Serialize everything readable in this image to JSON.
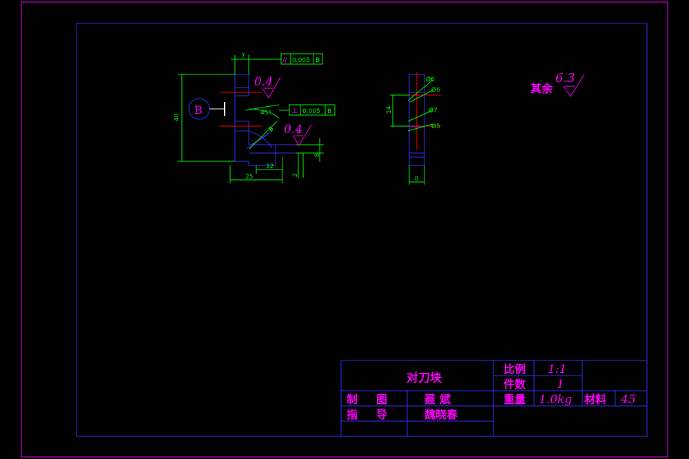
{
  "colors": {
    "background": "#000000",
    "outer_frame": "#ff00ff",
    "inner_frame": "#3333ff",
    "part": "#3333ff",
    "dimension": "#00ff00",
    "annotation": "#ff00ff",
    "centerline": "#ff0000"
  },
  "front_view": {
    "datum_label": "B",
    "dim_top": "7",
    "dim_height": "40",
    "dim_angle": "45°",
    "dim_chamfer": "8",
    "dim_12": "12",
    "dim_25": "25",
    "dim_8": "8",
    "dim_2": "2",
    "roughness_top": "0.4",
    "roughness_bottom": "0.4",
    "parallel_symbol": "//",
    "parallel_tolerance": "0.005",
    "parallel_datum": "B",
    "perp_symbol": "⊥",
    "perp_tolerance": "0.005",
    "perp_datum": "B"
  },
  "side_view": {
    "dim_14": "14",
    "dim_8": "8",
    "hole_dia_1": "Ø6",
    "hole_dia_2": "Ø6",
    "hole_dia_3": "Ø7",
    "hole_dia_4": "Ø5"
  },
  "other_roughness": {
    "label": "其余",
    "value": "6.3"
  },
  "title_block": {
    "part_name": "对刀块",
    "scale_label": "比例",
    "scale_value": "1:1",
    "count_label": "件数",
    "count_value": "1",
    "weight_label": "重量",
    "weight_value": "1.0kg",
    "material_label": "材料",
    "material_value": "45",
    "drawn_label_1": "制",
    "drawn_label_2": "图",
    "drawn_name": "聂斌",
    "guide_label_1": "指",
    "guide_label_2": "导",
    "guide_name": "魏晓春"
  }
}
